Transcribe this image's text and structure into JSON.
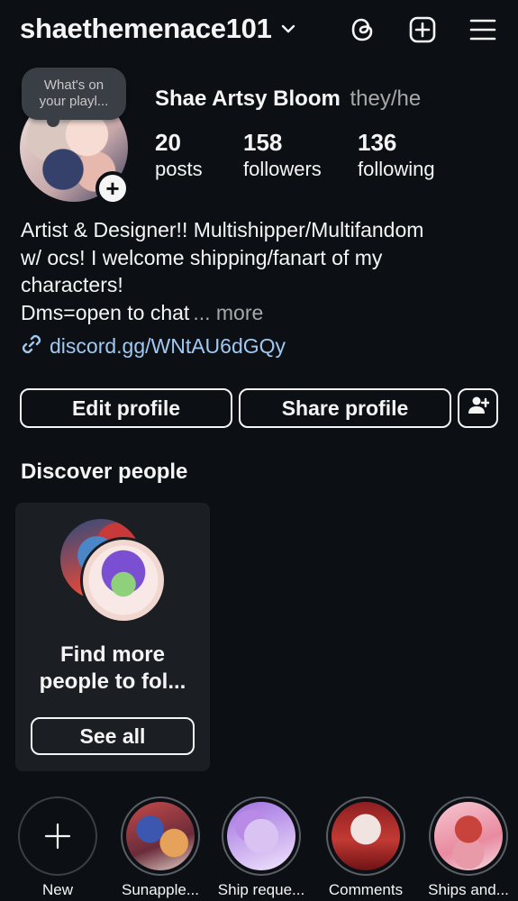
{
  "header": {
    "username": "shaethemenace101",
    "icons": [
      "chevron-down-icon",
      "threads-icon",
      "new-post-icon",
      "menu-icon"
    ]
  },
  "profile": {
    "note_line1": "What's on",
    "note_line2": "your playl...",
    "display_name": "Shae Artsy Bloom",
    "pronouns": "they/he",
    "stats": {
      "posts": {
        "value": "20",
        "label": "posts"
      },
      "followers": {
        "value": "158",
        "label": "followers"
      },
      "following": {
        "value": "136",
        "label": "following"
      }
    },
    "bio": {
      "line1": "Artist & Designer!! Multishipper/Multifandom",
      "line2": "w/ ocs! I welcome shipping/fanart of my",
      "line3": "characters!",
      "line4": "Dms=open to chat",
      "more": "... more"
    },
    "link": "discord.gg/WNtAU6dGQy"
  },
  "actions": {
    "edit": "Edit profile",
    "share": "Share profile"
  },
  "discover": {
    "title": "Discover people",
    "card_line1": "Find more",
    "card_line2": "people to fol...",
    "see_all": "See all"
  },
  "highlights": [
    {
      "label": "New"
    },
    {
      "label": "Sunapple..."
    },
    {
      "label": "Ship reque..."
    },
    {
      "label": "Comments"
    },
    {
      "label": "Ships and..."
    }
  ],
  "colors": {
    "background": "#0c1014",
    "link": "#a0c8f0",
    "muted": "#a8a8a8",
    "card": "#1b1f24"
  }
}
